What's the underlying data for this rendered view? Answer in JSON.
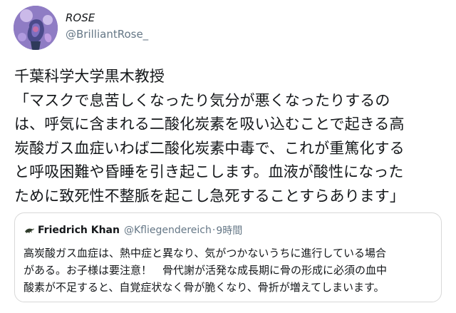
{
  "tweet": {
    "display_name": "ROSE",
    "handle": "@BrilliantRose_",
    "avatar_icon": "rose-avatar-icon",
    "body_lines": [
      "千葉科学大学黒木教授",
      "「マスクで息苦しくなったり気分が悪くなったりするの",
      "は、呼気に含まれる二酸化炭素を吸い込むことで起きる高",
      "炭酸ガス血症いわば二酸化炭素中毒で、これが重篤化する",
      "と呼吸困難や昏睡を引き起こします。血液が酸性になった",
      "ために致死性不整脈を起こし急死することすらあります」"
    ]
  },
  "quoted_tweet": {
    "avatar_icon": "lizard-avatar-icon",
    "display_name": "Friedrich Khan",
    "handle": "@Kfliegendereich",
    "separator": "·",
    "time": "9時間",
    "body_lines": [
      "高炭酸ガス血症は、熱中症と異なり、気がつかないうちに進行している場合",
      "がある。お子様は要注意！　骨代謝が活発な成長期に骨の形成に必須の血中",
      "酸素が不足すると、自覚症状なく骨が脆くなり、骨折が増えてしまいます。"
    ]
  },
  "colors": {
    "text": "#14171a",
    "secondary_text": "#657786",
    "card_border": "#d8d8d8",
    "background": "#ffffff"
  }
}
